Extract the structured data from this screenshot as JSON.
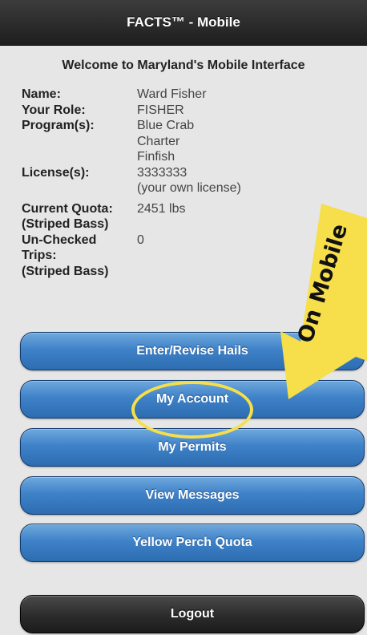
{
  "header": {
    "title": "FACTS™ - Mobile"
  },
  "welcome": "Welcome to Maryland's Mobile Interface",
  "profile": {
    "name_label": "Name:",
    "name_value": "Ward Fisher",
    "role_label": "Your Role:",
    "role_value": "FISHER",
    "programs_label": "Program(s):",
    "programs": [
      "Blue Crab",
      "Charter",
      "Finfish"
    ],
    "license_label": "License(s):",
    "license_value": "3333333",
    "license_note": "(your own license)",
    "quota_label_1": "Current Quota:",
    "quota_label_2": "(Striped Bass)",
    "quota_value": "2451 lbs",
    "unchecked_label_1": "Un-Checked",
    "unchecked_label_2": "Trips:",
    "unchecked_label_3": "(Striped Bass)",
    "unchecked_value": "0"
  },
  "menu": {
    "hails": "Enter/Revise Hails",
    "account": "My Account",
    "permits": "My Permits",
    "messages": "View Messages",
    "perch": "Yellow Perch Quota",
    "logout": "Logout"
  },
  "annotation": {
    "arrow_text": "On Mobile",
    "color": "#f6df4a"
  }
}
